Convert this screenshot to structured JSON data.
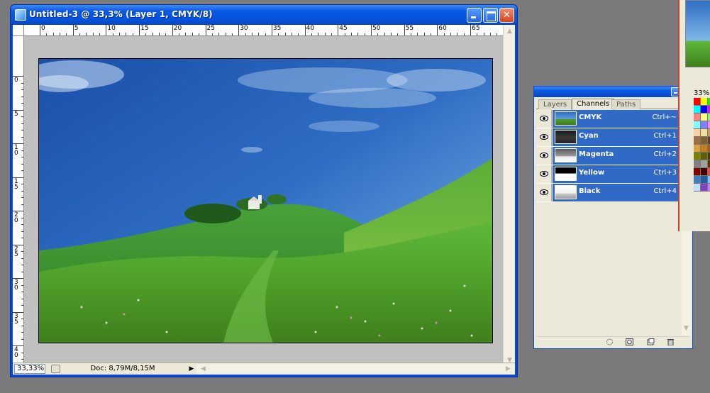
{
  "document": {
    "title": "Untitled-3 @ 33,3% (Layer 1, CMYK/8)",
    "zoom": "33,33%",
    "doc_info": "Doc: 8,79M/8,15M",
    "ruler_h_labels": [
      "0",
      "5",
      "10",
      "15",
      "20",
      "25",
      "30",
      "35",
      "40",
      "45",
      "50",
      "55",
      "60",
      "65"
    ],
    "ruler_v_labels": [
      "0",
      "5",
      "10",
      "15",
      "20",
      "25",
      "30",
      "35",
      "40"
    ]
  },
  "palette": {
    "tabs": [
      {
        "label": "Layers",
        "active": false
      },
      {
        "label": "Channels",
        "active": true
      },
      {
        "label": "Paths",
        "active": false
      }
    ],
    "channels": [
      {
        "name": "CMYK",
        "shortcut": "Ctrl+~",
        "thumb": "color"
      },
      {
        "name": "Cyan",
        "shortcut": "Ctrl+1",
        "thumb": "dark"
      },
      {
        "name": "Magenta",
        "shortcut": "Ctrl+2",
        "thumb": "mid"
      },
      {
        "name": "Yellow",
        "shortcut": "Ctrl+3",
        "thumb": "light"
      },
      {
        "name": "Black",
        "shortcut": "Ctrl+4",
        "thumb": "lightest"
      }
    ]
  },
  "background_window": {
    "zoom": "33%"
  },
  "colors": {
    "xp_title_blue": "#0a5ae6",
    "selection_blue": "#3169c6",
    "panel_bg": "#ece9d8",
    "desktop_gray": "#7a7a7a",
    "pasteboard_gray": "#c0c0c0"
  }
}
